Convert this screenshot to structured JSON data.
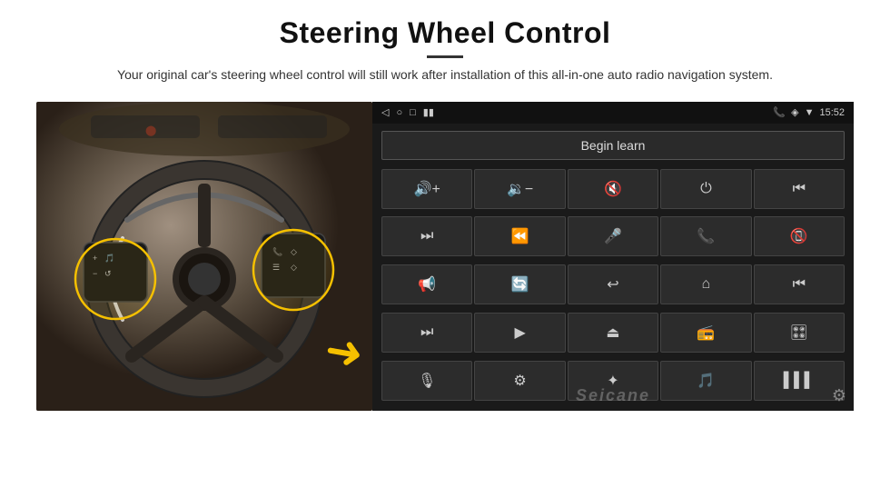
{
  "header": {
    "title": "Steering Wheel Control",
    "subtitle": "Your original car's steering wheel control will still work after installation of this all-in-one auto radio navigation system."
  },
  "status_bar": {
    "time": "15:52",
    "nav_back": "◁",
    "nav_home": "○",
    "nav_square": "□",
    "signal_icon": "▮▮",
    "phone_icon": "📞",
    "location_icon": "◈",
    "wifi_icon": "▼"
  },
  "begin_learn_btn": "Begin learn",
  "watermark": "Seicane",
  "controls": [
    {
      "id": "vol-up",
      "icon": "🔊+"
    },
    {
      "id": "vol-down",
      "icon": "🔉−"
    },
    {
      "id": "vol-mute",
      "icon": "🔇"
    },
    {
      "id": "power",
      "icon": "⏻"
    },
    {
      "id": "prev-track",
      "icon": "⏮"
    },
    {
      "id": "skip-forward",
      "icon": "⏭"
    },
    {
      "id": "seek-back",
      "icon": "⏪"
    },
    {
      "id": "mic",
      "icon": "🎤"
    },
    {
      "id": "phone",
      "icon": "📞"
    },
    {
      "id": "hang-up",
      "icon": "📵"
    },
    {
      "id": "horn",
      "icon": "📢"
    },
    {
      "id": "360-view",
      "icon": "🔄"
    },
    {
      "id": "back",
      "icon": "↩"
    },
    {
      "id": "home",
      "icon": "⌂"
    },
    {
      "id": "skip-back2",
      "icon": "⏮"
    },
    {
      "id": "fast-forward",
      "icon": "⏭"
    },
    {
      "id": "navigate",
      "icon": "▶"
    },
    {
      "id": "eject",
      "icon": "⏏"
    },
    {
      "id": "radio",
      "icon": "📻"
    },
    {
      "id": "equalizer",
      "icon": "🎛"
    },
    {
      "id": "mic2",
      "icon": "🎙"
    },
    {
      "id": "settings2",
      "icon": "⚙"
    },
    {
      "id": "bluetooth",
      "icon": "✦"
    },
    {
      "id": "music",
      "icon": "🎵"
    },
    {
      "id": "bars",
      "icon": "▌▌▌"
    }
  ]
}
